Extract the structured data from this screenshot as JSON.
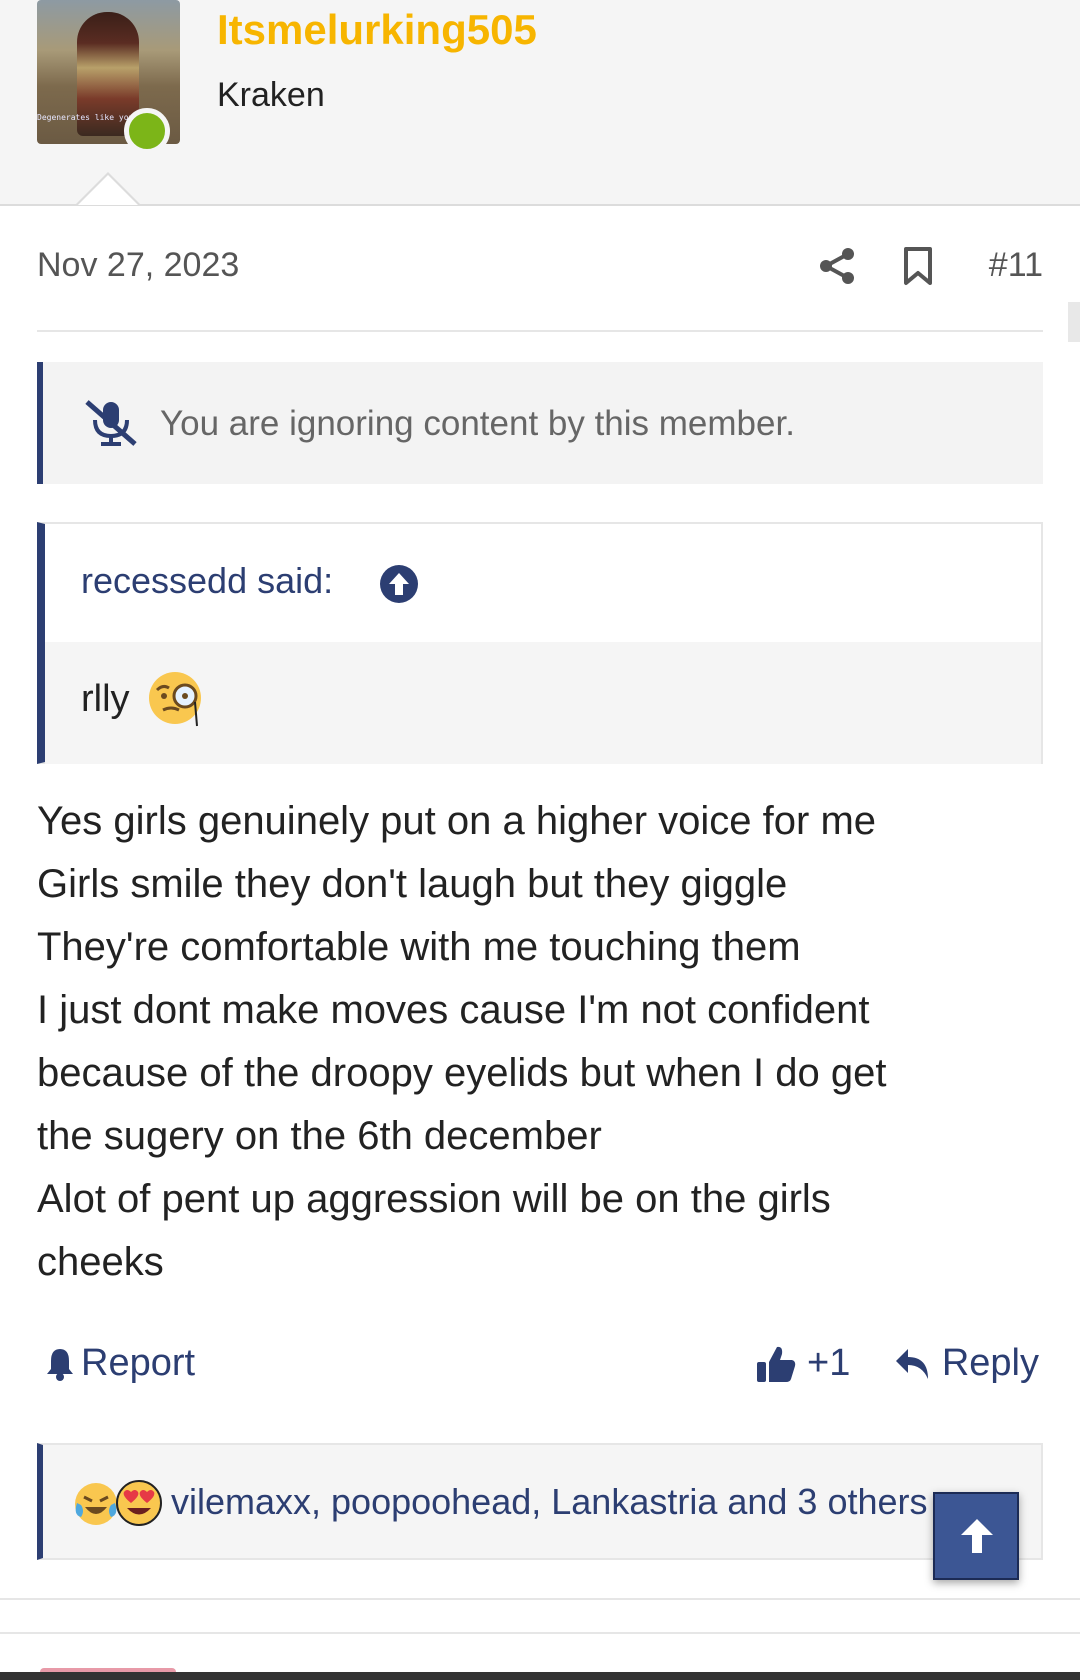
{
  "user": {
    "name": "Itsmelurking505",
    "title": "Kraken",
    "avatar_caption": "Degenerates like you bel",
    "status_color": "#7cb518",
    "name_color": "#f7b500"
  },
  "post": {
    "date": "Nov 27, 2023",
    "number": "#11",
    "ignore_notice": "You are ignoring content by this member.",
    "quote": {
      "author": "recessedd said:",
      "text": "rlly"
    },
    "body_lines": [
      "Yes girls genuinely put on a higher voice for me",
      "Girls smile they don't laugh but they giggle",
      "They're comfortable with me touching them",
      "I just dont make moves cause I'm not confident",
      "because of the droopy eyelids but when I do get",
      "the sugery on the 6th december",
      "Alot of pent up aggression will be on the girls",
      "cheeks"
    ]
  },
  "actions": {
    "report": "Report",
    "like": "+1",
    "reply": "Reply"
  },
  "reactions": {
    "summary": "vilemaxx, poopoohead, Lankastria and 3 others",
    "icons": [
      "laughing-crying-emoji",
      "heart-eyes-emoji"
    ]
  },
  "icons": {
    "share": "share-icon",
    "bookmark": "bookmark-icon",
    "ignore": "muted-microphone-icon",
    "quote_jump": "arrow-up-circle-icon",
    "scroll_top": "arrow-up-icon"
  },
  "colors": {
    "accent": "#2c3e72",
    "scroll_top_bg": "#3c5694"
  }
}
